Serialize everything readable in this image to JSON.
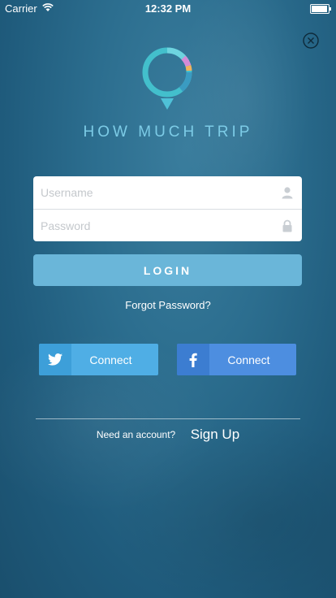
{
  "status_bar": {
    "carrier": "Carrier",
    "time": "12:32 PM",
    "battery_level": 1.0
  },
  "header": {
    "close_icon": "close-circle-icon",
    "app_title": "HOW MUCH TRIP",
    "logo_icon": "location-pin-logo"
  },
  "form": {
    "username_placeholder": "Username",
    "password_placeholder": "Password",
    "username_icon": "user-icon",
    "password_icon": "lock-icon"
  },
  "actions": {
    "login_label": "LOGIN",
    "forgot_label": "Forgot Password?"
  },
  "social": {
    "twitter_label": "Connect",
    "facebook_label": "Connect"
  },
  "footer": {
    "need_account": "Need an account?",
    "signup_label": "Sign Up"
  },
  "colors": {
    "background": "#2c6e8f",
    "accent": "#6ab6d9",
    "title": "#7ccbe6",
    "twitter": "#4faee5",
    "facebook": "#4d8ee0"
  }
}
